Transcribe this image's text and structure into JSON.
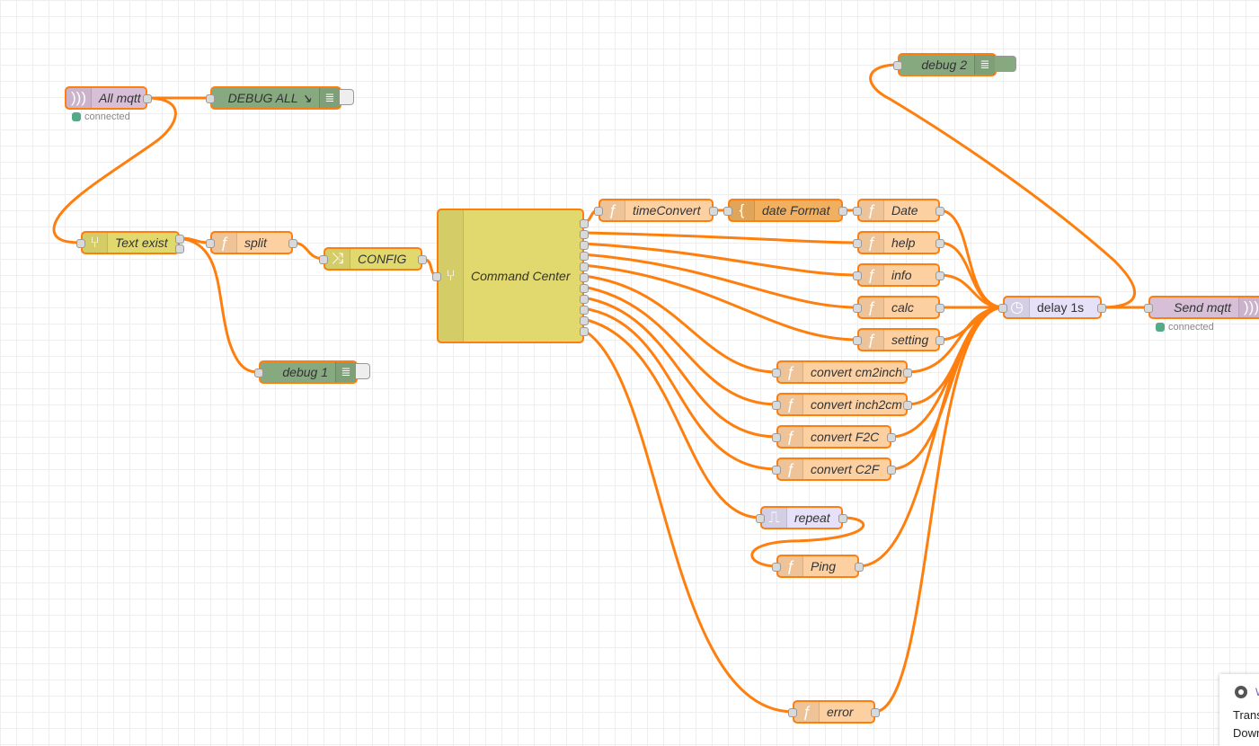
{
  "canvas": {
    "wire_color": "#ff7f0e",
    "grid_color": "#eeeeee"
  },
  "nodes": {
    "all_mqtt": {
      "label": "All mqtt",
      "type": "mqtt in",
      "icon": "radio-waves-icon",
      "status": "connected"
    },
    "debug_all": {
      "label": "DEBUG ALL ↘",
      "type": "debug",
      "icon": "list-icon"
    },
    "text_exist": {
      "label": "Text exist",
      "type": "switch",
      "icon": "switch-icon"
    },
    "split": {
      "label": "split",
      "type": "function",
      "icon": "function-icon"
    },
    "config": {
      "label": "CONFIG",
      "type": "change",
      "icon": "shuffle-icon"
    },
    "debug_1": {
      "label": "debug 1",
      "type": "debug",
      "icon": "list-icon"
    },
    "command_center": {
      "label": "Command Center",
      "type": "switch",
      "icon": "switch-icon",
      "outputs": 11
    },
    "time_convert": {
      "label": "timeConvert",
      "type": "function",
      "icon": "function-icon"
    },
    "date_format": {
      "label": "date Format",
      "type": "template",
      "icon": "brace-icon"
    },
    "date": {
      "label": "Date",
      "type": "function",
      "icon": "function-icon"
    },
    "help": {
      "label": "help",
      "type": "function",
      "icon": "function-icon"
    },
    "info": {
      "label": "info",
      "type": "function",
      "icon": "function-icon"
    },
    "calc": {
      "label": "calc",
      "type": "function",
      "icon": "function-icon"
    },
    "setting": {
      "label": "setting",
      "type": "function",
      "icon": "function-icon"
    },
    "cm2inch": {
      "label": "convert cm2inch",
      "type": "function",
      "icon": "function-icon"
    },
    "inch2cm": {
      "label": "convert inch2cm",
      "type": "function",
      "icon": "function-icon"
    },
    "f2c": {
      "label": "convert F2C",
      "type": "function",
      "icon": "function-icon"
    },
    "c2f": {
      "label": "convert C2F",
      "type": "function",
      "icon": "function-icon"
    },
    "repeat": {
      "label": "repeat",
      "type": "trigger",
      "icon": "pulse-icon"
    },
    "ping": {
      "label": "Ping",
      "type": "function",
      "icon": "function-icon"
    },
    "error": {
      "label": "error",
      "type": "function",
      "icon": "function-icon"
    },
    "delay": {
      "label": "delay 1s",
      "type": "delay",
      "icon": "timer-icon"
    },
    "debug_2": {
      "label": "debug 2",
      "type": "debug",
      "icon": "list-icon"
    },
    "send_mqtt": {
      "label": "Send mqtt",
      "type": "mqtt out",
      "icon": "radio-waves-icon",
      "status": "connected"
    }
  },
  "toast": {
    "title": "W",
    "line1": "Trans",
    "line2": "Down"
  }
}
